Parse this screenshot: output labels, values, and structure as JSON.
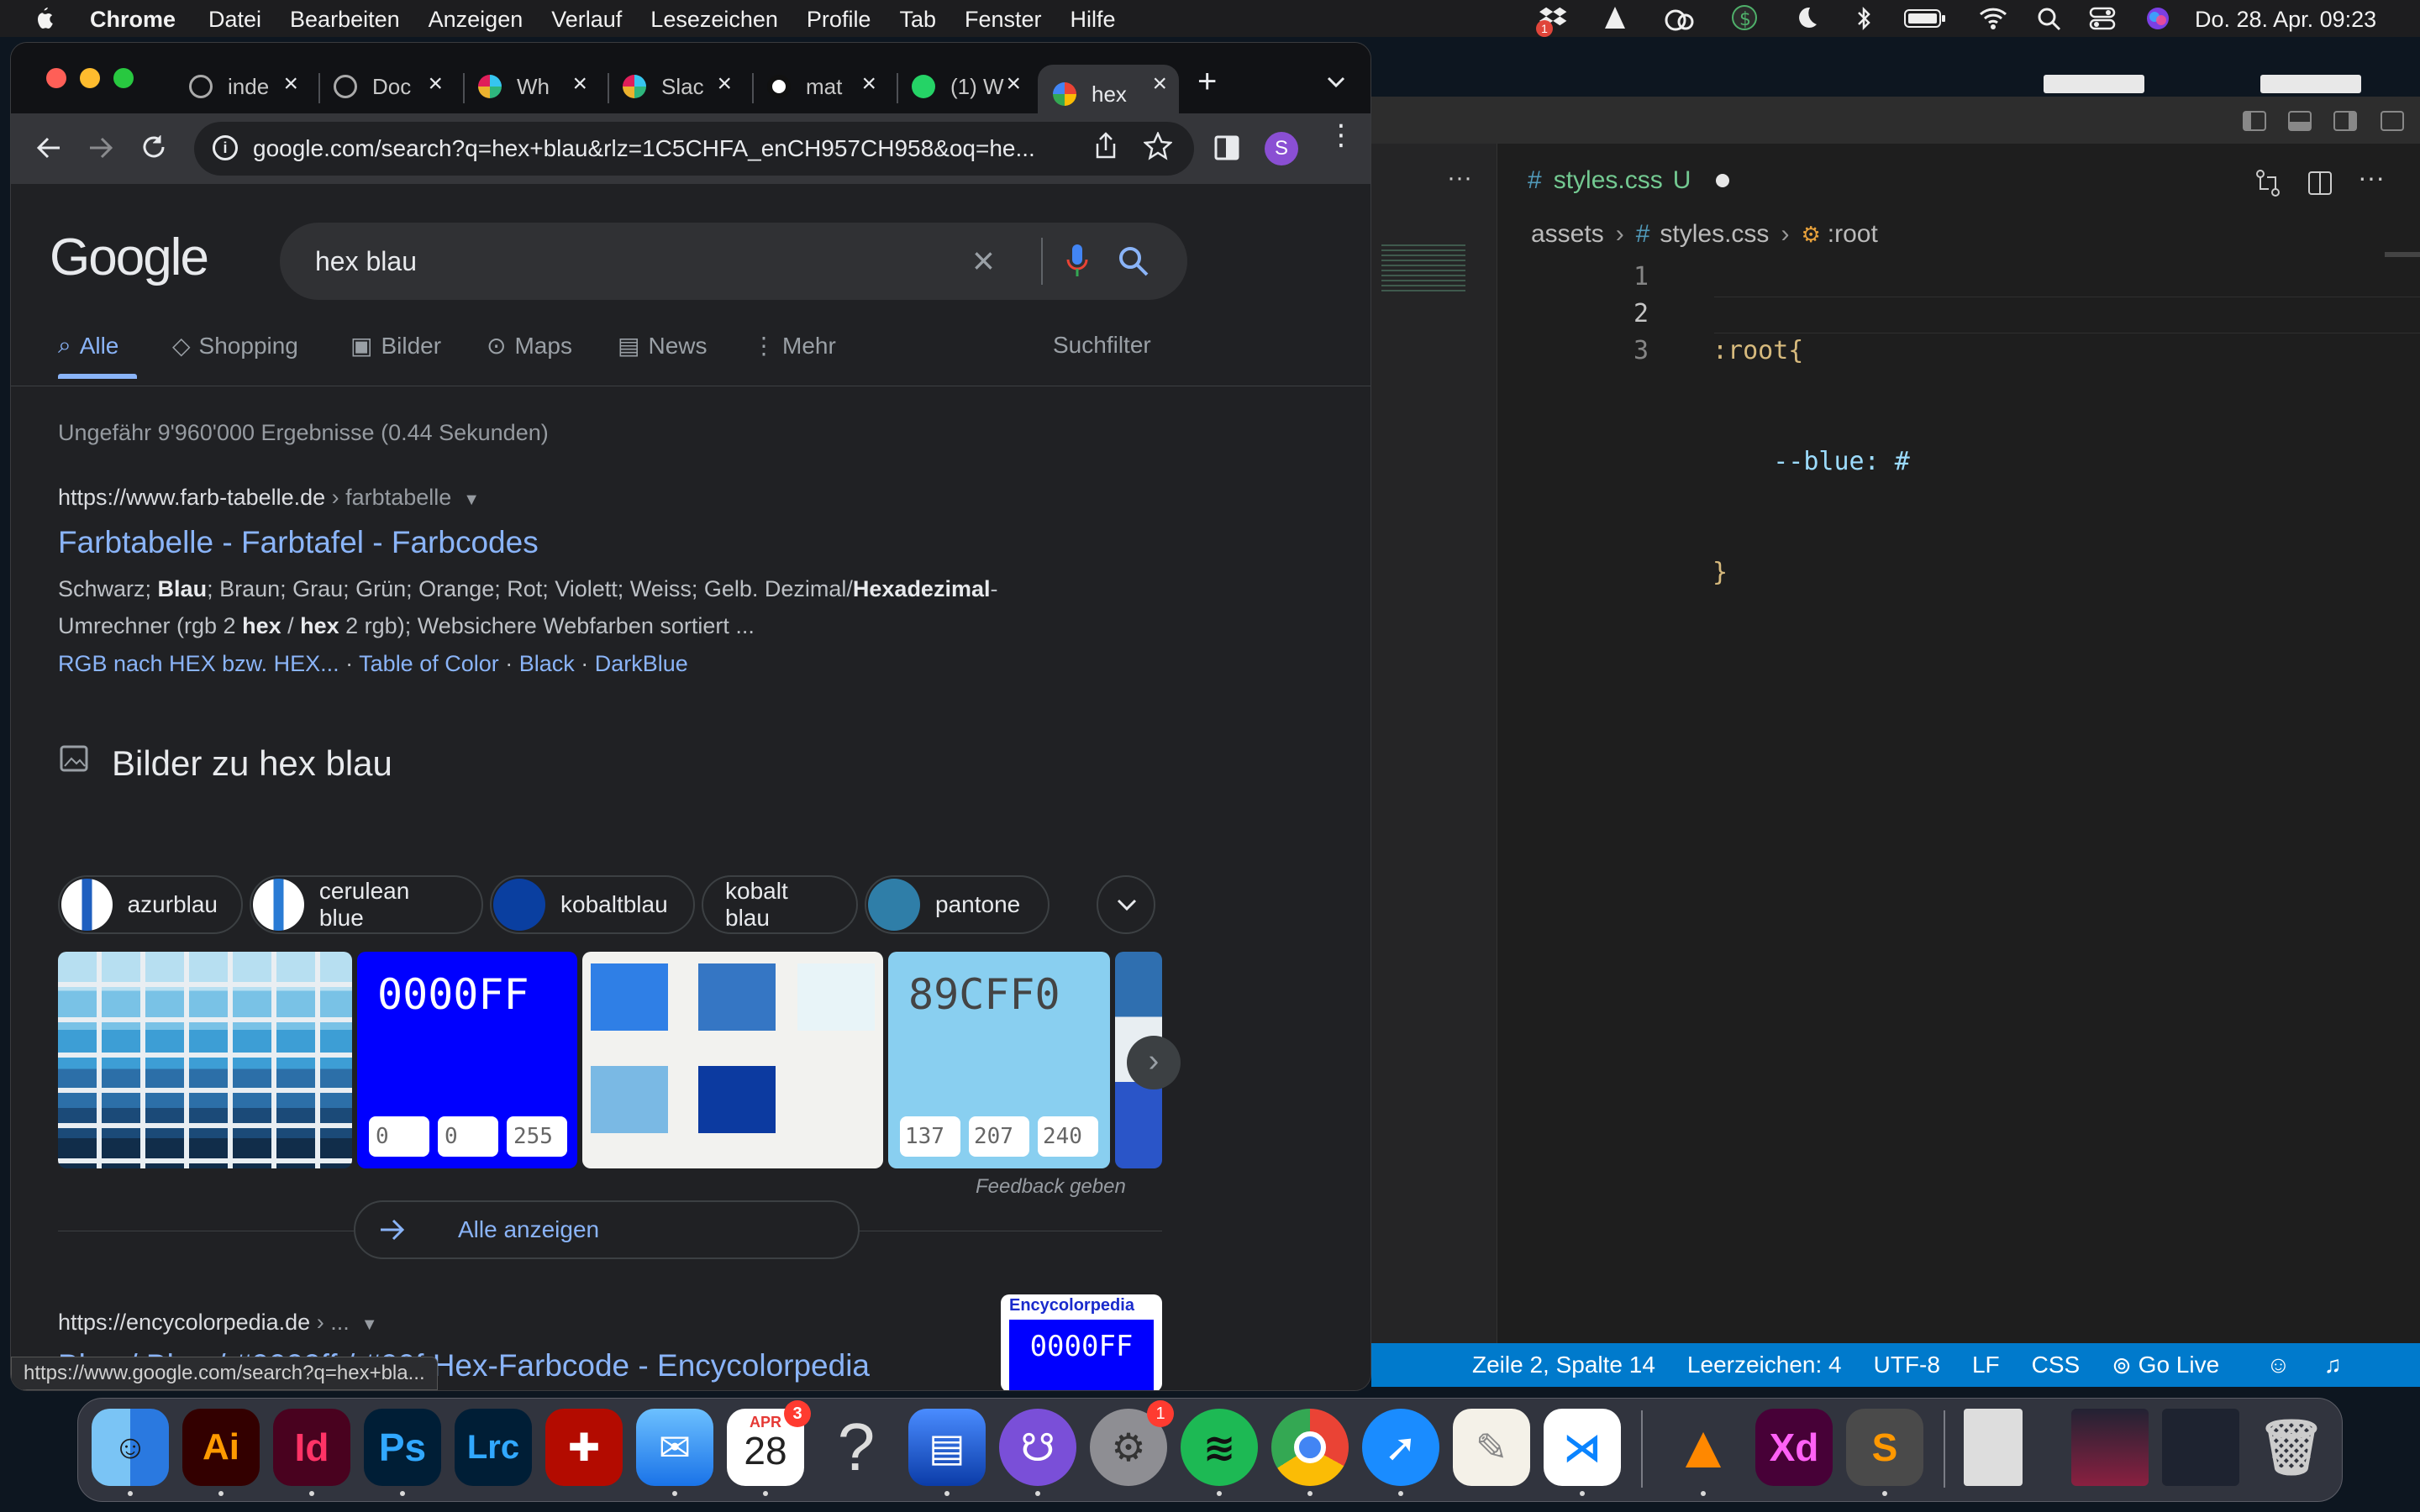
{
  "menubar": {
    "apple": "",
    "app": "Chrome",
    "items": [
      "Datei",
      "Bearbeiten",
      "Anzeigen",
      "Verlauf",
      "Lesezeichen",
      "Profile",
      "Tab",
      "Fenster",
      "Hilfe"
    ],
    "clock": "Do. 28. Apr.  09:23",
    "dropbox_badge": "1"
  },
  "chrome": {
    "tabs": [
      {
        "title": "inde",
        "icon": "globe-icon"
      },
      {
        "title": "Doc",
        "icon": "globe-icon"
      },
      {
        "title": "Wh",
        "icon": "slack-icon"
      },
      {
        "title": "Slac",
        "icon": "slack-icon"
      },
      {
        "title": "mat",
        "icon": "mattermost-icon"
      },
      {
        "title": "(1) W",
        "icon": "whatsapp-icon"
      },
      {
        "title": "hex",
        "icon": "google-icon"
      }
    ],
    "new_tab": "+",
    "url": "google.com/search?q=hex+blau&rlz=1C5CHFA_enCH957CH958&oq=he...",
    "profile": "S",
    "status_url": "https://www.google.com/search?q=hex+bla..."
  },
  "google": {
    "logo": "Google",
    "query": "hex blau",
    "nav": [
      "Alle",
      "Shopping",
      "Bilder",
      "Maps",
      "News",
      "Mehr"
    ],
    "filter": "Suchfilter",
    "stats": "Ungefähr 9'960'000 Ergebnisse (0.44 Sekunden)",
    "result1": {
      "url": "https://www.farb-tabelle.de",
      "crumb": " › farbtabelle",
      "title": "Farbtabelle - Farbtafel - Farbcodes",
      "snip_a": "Schwarz; ",
      "snip_b": "Blau",
      "snip_c": "; Braun; Grau; Grün; Orange; Rot; Violett; Weiss; Gelb. Dezimal/",
      "snip_d": "Hexadezimal",
      "snip_e": "-",
      "snip2_a": "Umrechner (rgb 2 ",
      "snip2_b": "hex",
      "snip2_c": " / ",
      "snip2_d": "hex",
      "snip2_e": " 2 rgb); Websichere Webfarben sortiert ...",
      "sitelinks": [
        "RGB nach HEX bzw. HEX...",
        "Table of Color",
        "Black",
        "DarkBlue"
      ]
    },
    "images_heading": "Bilder zu hex blau",
    "chips": [
      "azurblau",
      "cerulean blue",
      "kobaltblau",
      "kobalt blau",
      "pantone"
    ],
    "img2": {
      "code": "0000FF",
      "r": "0",
      "g": "0",
      "b": "255"
    },
    "img4": {
      "code": "89CFF0",
      "r": "137",
      "g": "207",
      "b": "240"
    },
    "feedback": "Feedback geben",
    "show_all": "Alle anzeigen",
    "result2": {
      "url": "https://encycolorpedia.de",
      "crumb": " › ...",
      "title": "Blau / Blau / #0000ff / #00f Hex-Farbcode - Encycolorpedia",
      "thumb_brand": "Encycolorpedia",
      "thumb_code": "0000FF"
    }
  },
  "vscode": {
    "tab": "styles.css",
    "tab_status": "U",
    "breadcrumb": [
      "assets",
      "styles.css",
      ":root"
    ],
    "lines": [
      "1",
      "2",
      "3"
    ],
    "code": [
      ":root{",
      "    --blue: #",
      "}"
    ],
    "status": [
      "Zeile 2, Spalte 14",
      "Leerzeichen: 4",
      "UTF-8",
      "LF",
      "CSS",
      "Go Live"
    ]
  },
  "dock": {
    "apps": [
      "finder",
      "illustrator",
      "indesign",
      "photoshop",
      "lightroom-classic",
      "acrobat",
      "mail",
      "calendar",
      "help",
      "preview-scan",
      "github-desktop",
      "system-preferences",
      "spotify",
      "chrome",
      "safari",
      "textedit",
      "vscode",
      "vlc",
      "xd",
      "sublime"
    ],
    "labels": {
      "ai": "Ai",
      "id": "Id",
      "ps": "Ps",
      "lrc": "Lrc",
      "xd": "Xd"
    },
    "calendar_month": "APR",
    "calendar_day": "28",
    "calendar_badge": "3",
    "settings_badge": "1"
  }
}
